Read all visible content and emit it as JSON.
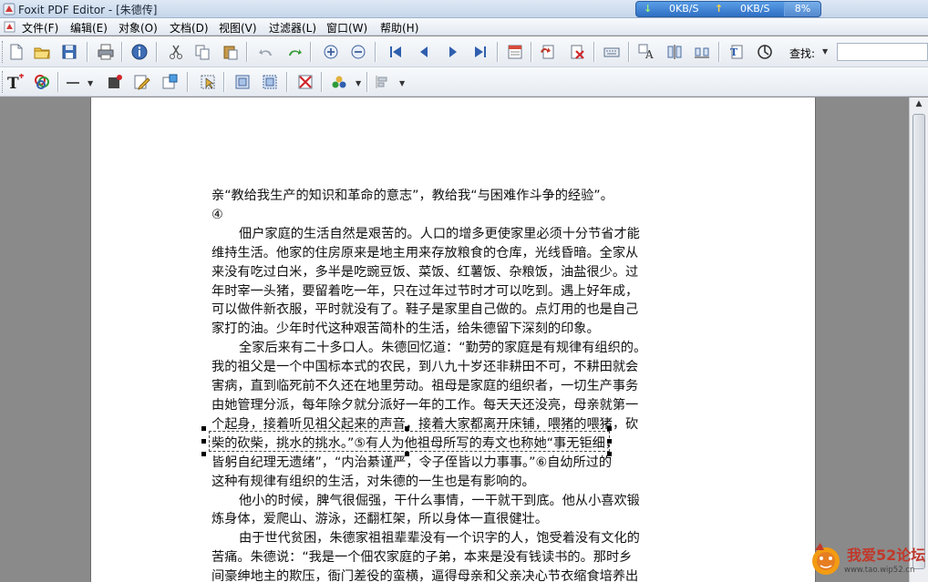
{
  "window": {
    "title": "Foxit PDF Editor - [朱德传]",
    "net_monitor": {
      "down": "0KB/S",
      "up": "0KB/S",
      "cpu": "8%"
    }
  },
  "menu": [
    "文件(F)",
    "编辑(E)",
    "对象(O)",
    "文档(D)",
    "视图(V)",
    "过滤器(L)",
    "窗口(W)",
    "帮助(H)"
  ],
  "toolbar": {
    "find_label": "查找:",
    "find_value": ""
  },
  "document": {
    "lines": [
      {
        "text": "亲“教给我生产的知识和革命的意志”，教给我“与困难作斗争的经验”。",
        "indent": false
      },
      {
        "text": "④",
        "indent": false
      },
      {
        "text": "佃户家庭的生活自然是艰苦的。人口的增多更使家里必须十分节省才能",
        "indent": true
      },
      {
        "text": "维持生活。他家的住房原来是地主用来存放粮食的仓库，光线昏暗。全家从",
        "indent": false
      },
      {
        "text": "来没有吃过白米，多半是吃豌豆饭、菜饭、红薯饭、杂粮饭，油盐很少。过",
        "indent": false
      },
      {
        "text": "年时宰一头猪，要留着吃一年，只在过年过节时才可以吃到。遇上好年成，",
        "indent": false
      },
      {
        "text": "可以做件新衣服，平时就没有了。鞋子是家里自己做的。点灯用的也是自己",
        "indent": false
      },
      {
        "text": "家打的油。少年时代这种艰苦简朴的生活，给朱德留下深刻的印象。",
        "indent": false
      },
      {
        "text": "全家后来有二十多口人。朱德回忆道：“勤劳的家庭是有规律有组织的。",
        "indent": true
      },
      {
        "text": "我的祖父是一个中国标本式的农民，到八九十岁还非耕田不可，不耕田就会",
        "indent": false
      },
      {
        "text": "害病，直到临死前不久还在地里劳动。祖母是家庭的组织者，一切生产事务",
        "indent": false
      },
      {
        "text": "由她管理分派，每年除夕就分派好一年的工作。每天天还没亮，母亲就第一",
        "indent": false
      },
      {
        "text": "个起身，接着听见祖父起来的声音，接着大家都离开床铺，喂猪的喂猪，砍",
        "indent": false
      },
      {
        "text": "柴的砍柴，挑水的挑水。”⑤有人为他祖母所写的寿文也称她“事无钜细，",
        "indent": false
      },
      {
        "text": "皆躬自纪理无遗绪”，“内治綦谨严，令子侄皆以力事事。”⑥自幼所过的",
        "indent": false
      },
      {
        "text": "这种有规律有组织的生活，对朱德的一生也是有影响的。",
        "indent": false
      },
      {
        "text": "他小的时候，脾气很倔强，干什么事情，一干就干到底。他从小喜欢锻",
        "indent": true
      },
      {
        "text": "炼身体，爱爬山、游泳，还翻杠架，所以身体一直很健壮。",
        "indent": false
      },
      {
        "text": "由于世代贫困，朱德家祖祖辈辈没有一个识字的人，饱受着没有文化的",
        "indent": true
      },
      {
        "text": "苦痛。朱德说：“我是一个佃农家庭的子弟，本来是没有钱读书的。那时乡",
        "indent": false
      },
      {
        "text": "间豪绅地主的欺压，衙门差役的蛮横，逼得母亲和父亲决心节衣缩食培养出",
        "indent": false
      }
    ]
  },
  "watermark": {
    "title": "我爱52论坛",
    "url": "www.tao.wip52.cn"
  },
  "colors": {
    "accent": "#2f6fc4",
    "page": "#ffffff",
    "workspace": "#8a8a8a"
  }
}
